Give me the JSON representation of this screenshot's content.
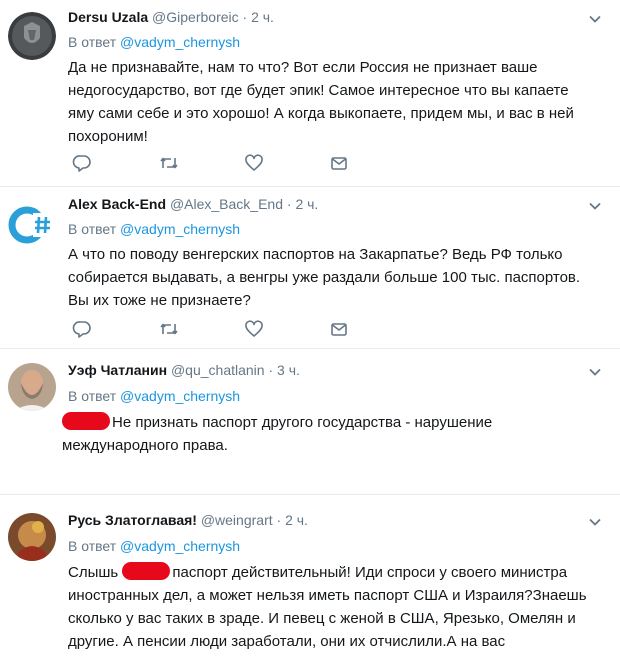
{
  "tweets": [
    {
      "name": "Dersu Uzala",
      "handle": "@Giperboreic",
      "dot": "·",
      "time": "2 ч.",
      "reply_prefix": "В ответ",
      "reply_mention": "@vadym_chernysh",
      "text": "Да не признавайте, нам то что? Вот если Россия не признает ваше недогосударство, вот где будет эпик! Самое интересное что вы капаете яму сами себе и это хорошо! А когда выкопаете, придем мы, и вас в ней похороним!"
    },
    {
      "name": "Alex Back-End",
      "handle": "@Alex_Back_End",
      "dot": "·",
      "time": "2 ч.",
      "reply_prefix": "В ответ",
      "reply_mention": "@vadym_chernysh",
      "text": "А что по поводу венгерских паспортов на Закарпатье? Ведь РФ только собирается выдавать, а венгры уже раздали больше 100 тыс. паспортов. Вы их тоже не признаете?"
    },
    {
      "name": "Уэф Чатланин",
      "handle": "@qu_chatlanin",
      "dot": "·",
      "time": "3 ч.",
      "reply_prefix": "В ответ",
      "reply_mention": "@vadym_chernysh",
      "text": "Не признать паспорт другого государства - нарушение международного права."
    },
    {
      "name": "Русь Златоглавая!",
      "handle": "@weingrart",
      "dot": "·",
      "time": "2 ч.",
      "reply_prefix": "В ответ",
      "reply_mention": "@vadym_chernysh",
      "text_before": "Слышь",
      "text_after": "паспорт действительный! Иди спроси у своего министра иностранных дел, а может нельзя иметь паспорт США и Израиля?Знаешь сколько у вас таких в зраде. И певец с женой в США, Ярезько, Омелян и другие. А пенсии люди заработали, они их отчислили.А на вас"
    }
  ],
  "icons": {
    "reply": "reply-icon",
    "retweet": "retweet-icon",
    "like": "heart-icon",
    "dm": "mail-icon",
    "menu": "chevron-down-icon"
  },
  "colors": {
    "link": "#1b95e0",
    "secondary": "#657786",
    "redaction": "#e8081c",
    "icon": "#657786"
  }
}
